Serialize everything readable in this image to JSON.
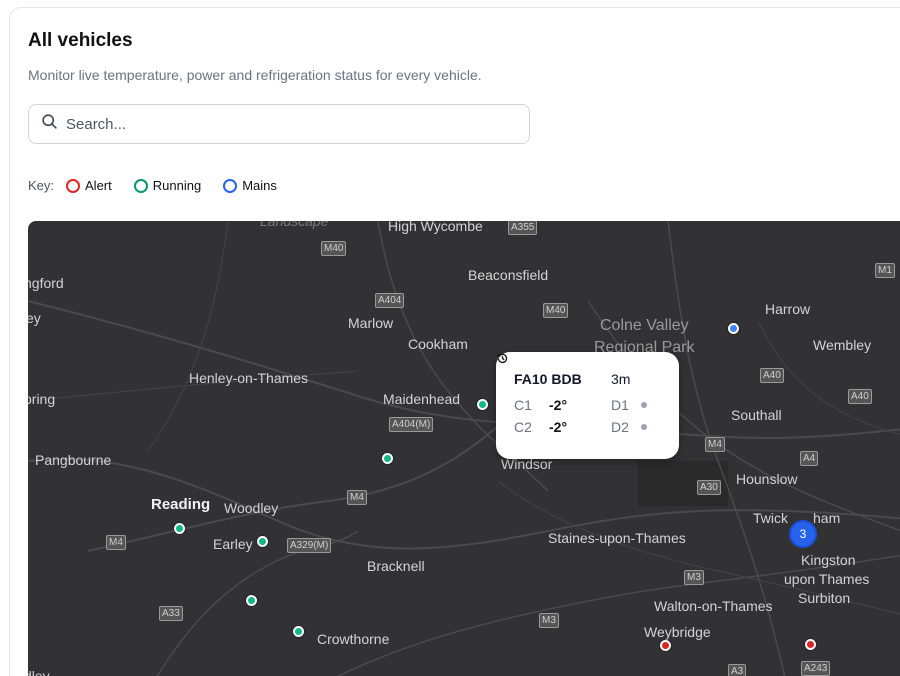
{
  "header": {
    "title": "All vehicles",
    "subtitle": "Monitor live temperature, power and refrigeration status for every vehicle."
  },
  "search": {
    "placeholder": "Search...",
    "icon": "search-icon"
  },
  "key": {
    "label": "Key:",
    "items": [
      {
        "label": "Alert",
        "color": "#dc2626"
      },
      {
        "label": "Running",
        "color": "#059669"
      },
      {
        "label": "Mains",
        "color": "#2563eb"
      }
    ]
  },
  "map": {
    "places": [
      "Landscape",
      "High Wycombe",
      "Beaconsfield",
      "ngford",
      "ey",
      "Marlow",
      "Cookham",
      "Colne Valley",
      "Regional Park",
      "Harrow",
      "Wembley",
      "Henley-on-Thames",
      "Maidenhead",
      "oring",
      "Southall",
      "Pangbourne",
      "Windsor",
      "Hounslow",
      "Reading",
      "Woodley",
      "Twick",
      "ham",
      "Earley",
      "Staines-upon-Thames",
      "Bracknell",
      "Kingston",
      "upon Thames",
      "Surbiton",
      "Walton-on-Thames",
      "Weybridge",
      "Crowthorne",
      "dley"
    ],
    "roads": [
      "A355",
      "M40",
      "M1",
      "A404",
      "M40",
      "A40",
      "A40",
      "A404(M)",
      "M4",
      "A4",
      "M4",
      "A30",
      "M4",
      "A329(M)",
      "M3",
      "A33",
      "M3",
      "A243",
      "A3"
    ],
    "cluster_count": "3",
    "marker_colors": {
      "alert": "#dc2626",
      "running": "#10b981",
      "mains": "#3b82f6"
    }
  },
  "popup": {
    "registration": "FA10 BDB",
    "time": "3m",
    "rows": [
      {
        "k1": "C1",
        "v1": "-2°",
        "k2": "D1"
      },
      {
        "k1": "C2",
        "v1": "-2°",
        "k2": "D2"
      }
    ]
  }
}
